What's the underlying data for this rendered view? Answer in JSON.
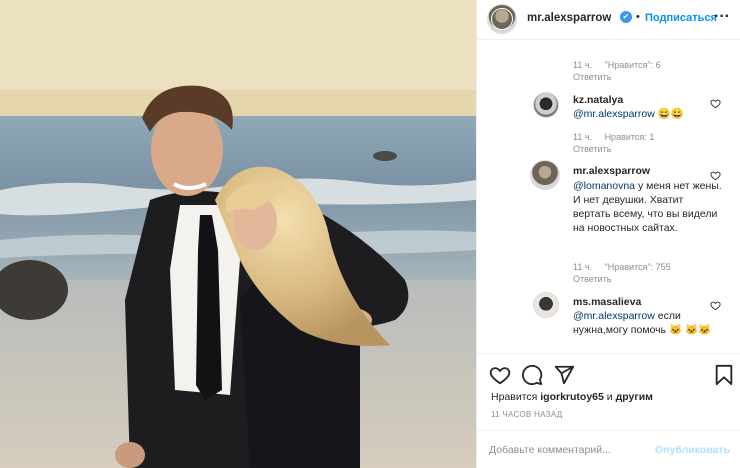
{
  "post": {
    "username": "mr.alexsparrow",
    "verified_glyph": "✔",
    "follow_label": "Подписаться",
    "separator": "•",
    "more_glyph": "···"
  },
  "comments": [
    {
      "meta_time": "11 ч.",
      "meta_likes": "\"Нравится\": 6",
      "reply": "Ответить"
    },
    {
      "username": "kz.natalya",
      "mention": "@mr.alexsparrow",
      "text": "😀😀",
      "meta_time": "11 ч.",
      "meta_likes": "Нравится: 1",
      "reply": "Ответить"
    },
    {
      "username": "mr.alexsparrow",
      "mention": "@lomanovna",
      "text": " у меня нет жены. И нет девушки. Хватит вертать всему, что вы видели на новостных сайтах.",
      "meta_time": "11 ч.",
      "meta_likes": "\"Нравится\": 755",
      "reply": "Ответить"
    },
    {
      "username": "ms.masalieva",
      "mention": "@mr.alexsparrow",
      "text": " если нужна,могу помочь 🐱 🐱🐱"
    }
  ],
  "actions": {
    "icons": [
      "heart-icon",
      "comment-icon",
      "share-icon",
      "bookmark-icon"
    ],
    "likes_prefix": "Нравится ",
    "likes_user": "igorkrutoy65",
    "likes_suffix": " и ",
    "likes_others": "другим",
    "time_ago": "11 ЧАСОВ НАЗАД"
  },
  "add_comment": {
    "placeholder": "Добавьте комментарий...",
    "publish_label": "Опубликовать"
  },
  "colors": {
    "accent": "#0095f6",
    "verified": "#3897f0",
    "muted": "#8e8e8e",
    "publish_disabled": "#b2dffc"
  }
}
